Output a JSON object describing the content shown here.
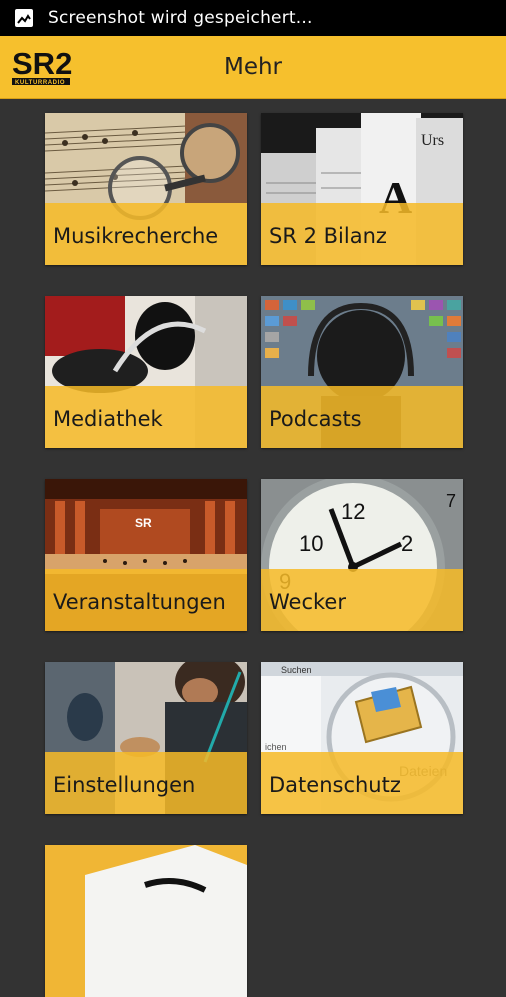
{
  "status_bar": {
    "notification_icon": "screenshot-icon",
    "text": "Screenshot wird gespeichert..."
  },
  "app_bar": {
    "logo_text": "SR2",
    "logo_subtext": "KULTURRADIO",
    "title": "Mehr"
  },
  "tiles": [
    {
      "label": "Musikrecherche"
    },
    {
      "label": "SR 2 Bilanz"
    },
    {
      "label": "Mediathek"
    },
    {
      "label": "Podcasts"
    },
    {
      "label": "Veranstaltungen"
    },
    {
      "label": "Wecker"
    },
    {
      "label": "Einstellungen"
    },
    {
      "label": "Datenschutz"
    },
    {
      "label": ""
    }
  ],
  "colors": {
    "accent": "#f6c02d",
    "background": "#333333",
    "status_bar": "#000000"
  }
}
